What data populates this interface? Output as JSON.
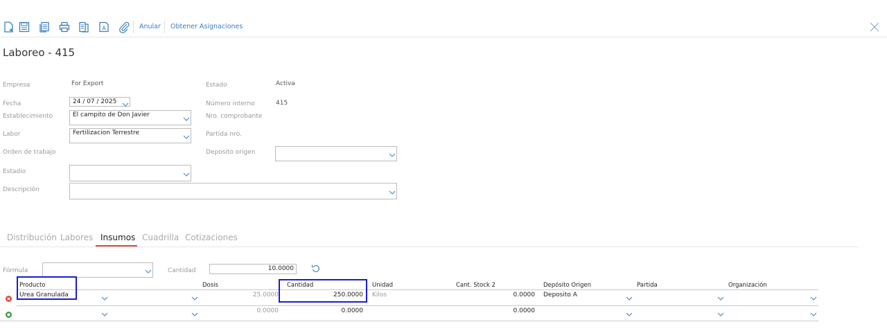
{
  "toolbar": {
    "icons": [
      "new-doc-icon",
      "save-icon",
      "copy-icon",
      "print-icon",
      "report-icon",
      "text-icon",
      "attach-icon"
    ],
    "anular_label": "Anular",
    "asignaciones_label": "Obtener Asignaciones"
  },
  "page": {
    "title": "Laboreo - 415"
  },
  "form": {
    "empresa_label": "Empresa",
    "empresa_value": "For Export",
    "estado_label": "Estado",
    "estado_value": "Activa",
    "fecha_label": "Fecha",
    "fecha_value": "24 / 07 /  2025",
    "numero_interno_label": "Número interno",
    "numero_interno_value": "415",
    "establecimiento_label": "Establecimiento",
    "establecimiento_value": "El campito de Don Javier",
    "nro_comprobante_label": "Nro. comprobante",
    "labor_label": "Labor",
    "labor_value": "Fertilizacion Terrestre",
    "partida_nro_label": "Partida nro.",
    "orden_trabajo_label": "Orden de trabajo",
    "deposito_origen_label": "Deposito origen",
    "estadio_label": "Estadio",
    "descripcion_label": "Descripción"
  },
  "tabs": [
    {
      "label": "Distribución",
      "active": false
    },
    {
      "label": "Labores",
      "active": false
    },
    {
      "label": "Insumos",
      "active": true
    },
    {
      "label": "Cuadrilla",
      "active": false
    },
    {
      "label": "Cotizaciones",
      "active": false
    }
  ],
  "insumos": {
    "formula_label": "Fórmula",
    "cantidad_label": "Cantidad",
    "cantidad_value": "10.0000",
    "columns": [
      "Producto",
      "Dosis",
      "Cantidad",
      "Unidad",
      "Cant. Stock 2",
      "Depósito Origen",
      "Partida",
      "Organización"
    ],
    "rows": [
      {
        "producto": "Urea Granulada",
        "dosis": "25.0000",
        "cantidad": "250.0000",
        "unidad": "Kilos",
        "stock2": "0.0000",
        "deposito": "Deposito A"
      },
      {
        "producto": "",
        "dosis": "0.0000",
        "cantidad": "0.0000",
        "unidad": "",
        "stock2": "0.0000",
        "deposito": ""
      }
    ]
  },
  "colors": {
    "accent_red": "#e0463c",
    "link_blue": "#3a7fc1",
    "highlight_blue": "#1a1adb",
    "add_green": "#3c9a3c"
  }
}
